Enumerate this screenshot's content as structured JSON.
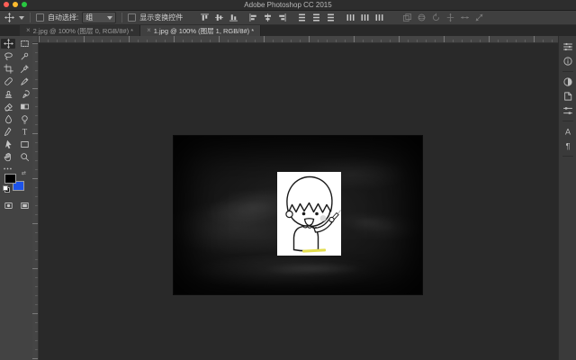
{
  "window": {
    "title": "Adobe Photoshop CC 2015"
  },
  "titlebar": {
    "traffic_lights": [
      "close",
      "minimize",
      "fullscreen"
    ],
    "traffic_colors": [
      "#ff5f57",
      "#febc2e",
      "#28c840"
    ]
  },
  "options_bar": {
    "active_tool_icon": "move",
    "auto_select_label": "自动选择:",
    "auto_select_value": "组",
    "auto_select_checked": false,
    "show_transform_label": "显示变换控件",
    "show_transform_checked": false,
    "align_icons": [
      "align-top",
      "align-middle",
      "align-bottom",
      "align-left",
      "align-center",
      "align-right",
      "distribute-top",
      "distribute-middle",
      "distribute-bottom",
      "distribute-left",
      "distribute-center",
      "distribute-right"
    ],
    "extra_icons": [
      "auto-align",
      "3d-rotate",
      "3d-roll",
      "3d-pan",
      "3d-slide",
      "3d-scale"
    ]
  },
  "tabs": [
    {
      "close": "×",
      "label": "2.jpg @ 100% (图层 0, RGB/8#) *",
      "active": false
    },
    {
      "close": "×",
      "label": "1.jpg @ 100% (图层 1, RGB/8#) *",
      "active": true
    }
  ],
  "toolbar": {
    "tools": [
      "move",
      "marquee",
      "lasso",
      "quick-select",
      "crop",
      "eyedropper",
      "spot-healing",
      "brush",
      "clone-stamp",
      "history-brush",
      "eraser",
      "gradient",
      "blur",
      "dodge",
      "pen",
      "type",
      "path-select",
      "rectangle",
      "hand",
      "zoom"
    ],
    "selected_tool": "move",
    "more_icon": "ellipsis",
    "swap_glyph": "⇄",
    "foreground_color": "#000000",
    "background_color": "#1d53e9",
    "bottom_icons": [
      "quick-mask",
      "screen-mode"
    ]
  },
  "right_dock": {
    "icons": [
      "color-panel",
      "info-panel",
      "adjustments-panel",
      "styles-panel",
      "properties-panel",
      "character-panel",
      "paragraph-panel"
    ]
  },
  "canvas": {
    "document_label": "1.jpg",
    "zoom_level": "100%",
    "content": "dark chalkboard photo",
    "sticker": "white cartoon child (Chibi Maruko-chan) drawing with chalk",
    "chalk_line_color": "#e3dd4e"
  }
}
